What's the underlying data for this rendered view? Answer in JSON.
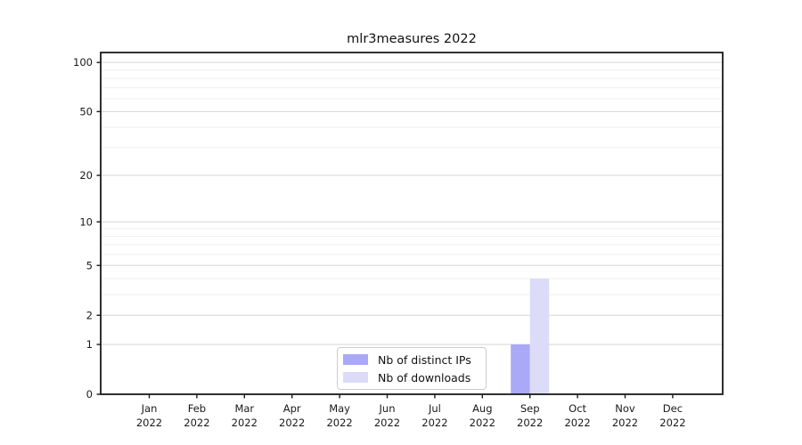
{
  "chart_data": {
    "type": "bar",
    "title": "mlr3measures 2022",
    "x_tick_months": [
      "Jan",
      "Feb",
      "Mar",
      "Apr",
      "May",
      "Jun",
      "Jul",
      "Aug",
      "Sep",
      "Oct",
      "Nov",
      "Dec"
    ],
    "x_tick_year": "2022",
    "series": [
      {
        "name": "Nb of distinct IPs",
        "color": "#a9a9f7",
        "values": [
          0,
          0,
          0,
          0,
          0,
          0,
          0,
          0,
          1,
          0,
          0,
          0
        ]
      },
      {
        "name": "Nb of downloads",
        "color": "#dcdcf9",
        "values": [
          0,
          0,
          0,
          0,
          0,
          0,
          0,
          0,
          4,
          0,
          0,
          0
        ]
      }
    ],
    "y_axis": {
      "scale": "log1p",
      "ticks": [
        0,
        1,
        2,
        5,
        10,
        20,
        50,
        100
      ],
      "minor_ticks": [
        3,
        4,
        6,
        7,
        8,
        9,
        30,
        40,
        60,
        70,
        80,
        90
      ],
      "ylim": [
        0,
        115
      ]
    },
    "grid": true,
    "legend_position": "lower center",
    "colors": {
      "grid_major": "#d6d6d6",
      "grid_minor": "#efefef",
      "spine": "#1a1a1a",
      "text": "#1a1a1a",
      "legend_border": "#cccccc",
      "background": "#ffffff"
    }
  }
}
